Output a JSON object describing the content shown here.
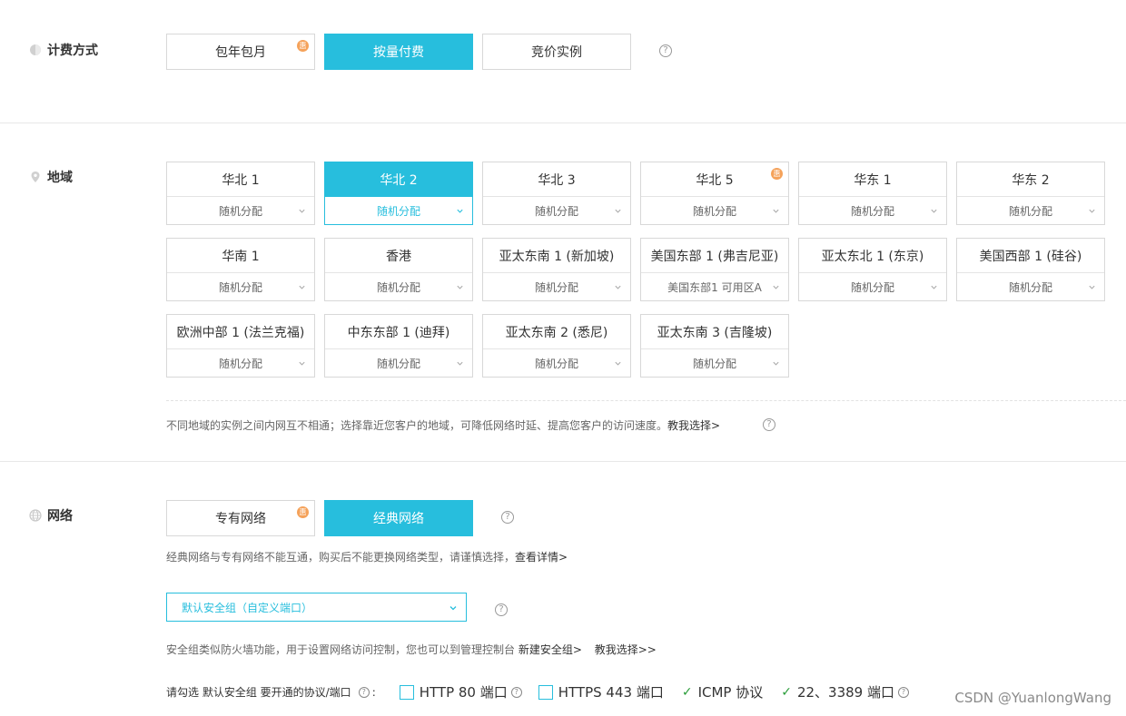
{
  "billing": {
    "label": "计费方式",
    "options": [
      "包年包月",
      "按量付费",
      "竞价实例"
    ],
    "hui_badge": "惠",
    "help": "?"
  },
  "region": {
    "label": "地域",
    "items": [
      {
        "name": "华北 1",
        "zone": "随机分配"
      },
      {
        "name": "华北 2",
        "zone": "随机分配"
      },
      {
        "name": "华北 3",
        "zone": "随机分配"
      },
      {
        "name": "华北 5",
        "zone": "随机分配"
      },
      {
        "name": "华东 1",
        "zone": "随机分配"
      },
      {
        "name": "华东 2",
        "zone": "随机分配"
      },
      {
        "name": "华南 1",
        "zone": "随机分配"
      },
      {
        "name": "香港",
        "zone": "随机分配"
      },
      {
        "name": "亚太东南 1 (新加坡)",
        "zone": "随机分配"
      },
      {
        "name": "美国东部 1 (弗吉尼亚)",
        "zone": "美国东部1 可用区A"
      },
      {
        "name": "亚太东北 1 (东京)",
        "zone": "随机分配"
      },
      {
        "name": "美国西部 1 (硅谷)",
        "zone": "随机分配"
      },
      {
        "name": "欧洲中部 1 (法兰克福)",
        "zone": "随机分配"
      },
      {
        "name": "中东东部 1 (迪拜)",
        "zone": "随机分配"
      },
      {
        "name": "亚太东南 2 (悉尼)",
        "zone": "随机分配"
      },
      {
        "name": "亚太东南 3 (吉隆坡)",
        "zone": "随机分配"
      }
    ],
    "note": "不同地域的实例之间内网互不相通；选择靠近您客户的地域，可降低网络时延、提高您客户的访问速度。",
    "note_link": "教我选择>"
  },
  "network": {
    "label": "网络",
    "options": [
      "专有网络",
      "经典网络"
    ],
    "note": "经典网络与专有网络不能互通，购买后不能更换网络类型，请谨慎选择，",
    "note_link": "查看详情>",
    "security_group": "默认安全组（自定义端口）",
    "sg_note": "安全组类似防火墙功能，用于设置网络访问控制，您也可以到管理控制台",
    "sg_new": "新建安全组>",
    "sg_teach": "教我选择>>",
    "ports_prompt": "请勾选 默认安全组 要开通的协议/端口",
    "ports": [
      {
        "label": "HTTP 80 端口"
      },
      {
        "label": "HTTPS 443 端口"
      },
      {
        "label": "ICMP 协议"
      },
      {
        "label": "22、3389 端口"
      }
    ]
  },
  "watermark": "CSDN @YuanlongWang"
}
